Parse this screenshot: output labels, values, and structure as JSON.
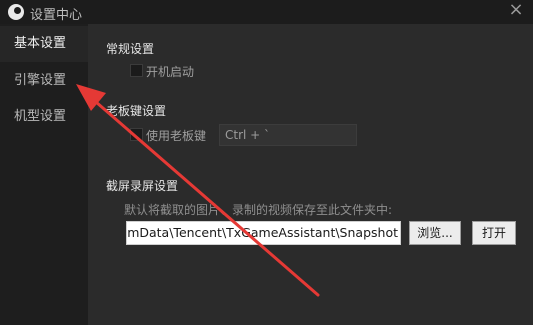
{
  "window": {
    "title": "设置中心",
    "close_glyph": "×"
  },
  "sidebar": {
    "items": [
      {
        "label": "基本设置",
        "active": true
      },
      {
        "label": "引擎设置",
        "active": false
      },
      {
        "label": "机型设置",
        "active": false
      }
    ]
  },
  "general": {
    "title": "常规设置",
    "autostart_label": "开机启动",
    "autostart_checked": false
  },
  "boss_key": {
    "title": "老板键设置",
    "enable_label": "使用老板键",
    "enable_checked": false,
    "hotkey_value": "Ctrl + `"
  },
  "screenshot": {
    "title": "截屏录屏设置",
    "description": "默认将截取的图片、录制的视频保存至此文件夹中:",
    "path_value": "C:\\ProgramData\\Tencent\\TxGameAssistant\\Snapshot",
    "browse_label": "浏览...",
    "open_label": "打开"
  },
  "colors": {
    "background": "#2b2b2b",
    "sidebar": "#1e1e1e",
    "annotation_arrow": "#e53935"
  }
}
